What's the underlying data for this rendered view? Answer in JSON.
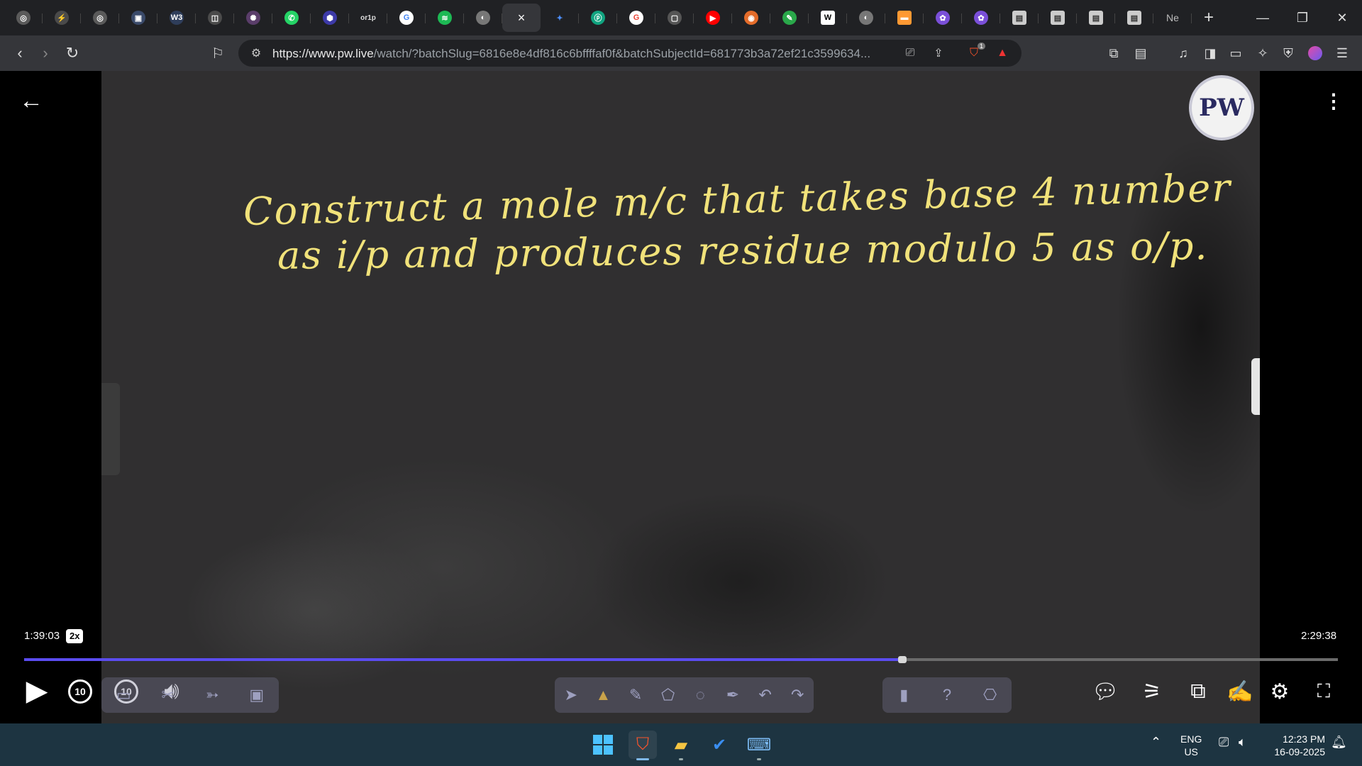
{
  "browser": {
    "tabs": [
      {
        "icon": "openai-icon",
        "glyph": "◎",
        "color": "#5a5a5a"
      },
      {
        "icon": "ai-logo-icon",
        "glyph": "⚡",
        "color": "#4a4a4a"
      },
      {
        "icon": "openai-icon",
        "glyph": "◎",
        "color": "#5a5a5a"
      },
      {
        "icon": "app-icon",
        "glyph": "▣",
        "color": "#3a4a6a"
      },
      {
        "icon": "w3schools-icon",
        "glyph": "W3",
        "color": "#2e3d5a"
      },
      {
        "icon": "app-icon",
        "glyph": "◫",
        "color": "#4a4a4a"
      },
      {
        "icon": "perplexity-icon",
        "glyph": "✺",
        "color": "#5a3d6a"
      },
      {
        "icon": "whatsapp-icon",
        "glyph": "✆",
        "color": "#25d366"
      },
      {
        "icon": "shield-app-icon",
        "glyph": "⬢",
        "color": "#3d3aa8"
      },
      {
        "icon": "text-logo-icon",
        "text": "or1p"
      },
      {
        "icon": "google-icon",
        "glyph": "G",
        "color": "#ffffff",
        "fg": "#4285f4"
      },
      {
        "icon": "spotify-icon",
        "glyph": "≋",
        "color": "#1db954"
      },
      {
        "icon": "globe-icon",
        "glyph": "◐",
        "color": "#777777"
      },
      {
        "icon": "close-icon",
        "close": "×",
        "active": true
      },
      {
        "icon": "gemini-icon",
        "glyph": "✦",
        "color": "#202124",
        "fg": "#4c8df6"
      },
      {
        "icon": "app-icon",
        "glyph": "ⓟ",
        "color": "#10a37f"
      },
      {
        "icon": "google-icon",
        "glyph": "G",
        "color": "#ffffff",
        "fg": "#ea4335"
      },
      {
        "icon": "app-icon",
        "glyph": "▢",
        "color": "#555555"
      },
      {
        "icon": "youtube-icon",
        "glyph": "▶",
        "color": "#ff0000"
      },
      {
        "icon": "app-icon",
        "glyph": "◉",
        "color": "#e46c2a"
      },
      {
        "icon": "app-icon",
        "glyph": "✎",
        "color": "#2aa84a"
      },
      {
        "icon": "wikipedia-icon",
        "glyph": "W",
        "color": "#ffffff",
        "fg": "#000000",
        "square": true
      },
      {
        "icon": "globe-icon",
        "glyph": "◐",
        "color": "#777777"
      },
      {
        "icon": "flag-india-icon",
        "glyph": "▬",
        "color": "#ff9933",
        "square": true
      },
      {
        "icon": "app-icon",
        "glyph": "✿",
        "color": "#7a4fd8"
      },
      {
        "icon": "app-icon",
        "glyph": "✿",
        "color": "#7a4fd8"
      },
      {
        "icon": "doc-icon",
        "glyph": "▤",
        "color": "#cccccc",
        "fg": "#333333",
        "square": true
      },
      {
        "icon": "doc-icon",
        "glyph": "▤",
        "color": "#cccccc",
        "fg": "#333333",
        "square": true
      },
      {
        "icon": "doc-icon",
        "glyph": "▤",
        "color": "#cccccc",
        "fg": "#333333",
        "square": true
      },
      {
        "icon": "doc-icon",
        "glyph": "▤",
        "color": "#cccccc",
        "fg": "#333333",
        "square": true
      },
      {
        "text_label": "Ne"
      }
    ],
    "new_tab": "+",
    "url": "https://www.pw.live/watch/?batchSlug=6816e8e4df816c6bffffaf0f&batchSubjectId=681773b3a72ef21c3599634...",
    "url_host": "https://www.pw.live",
    "url_rest": "/watch/?batchSlug=6816e8e4df816c6bffffaf0f&batchSubjectId=681773b3a72ef21c3599634...",
    "shield_badge": "1"
  },
  "player": {
    "board_line_1": "Construct a mole m/c that takes base 4 number",
    "board_line_2": "as i/p and produces residue modulo 5 as o/p.",
    "logo_text": "PW",
    "time_current": "1:39:03",
    "speed": "2x",
    "time_total": "2:29:38",
    "progress": 0.6685,
    "rewind_label": "10",
    "forward_label": "10"
  },
  "taskbar": {
    "lang_1": "ENG",
    "lang_2": "US",
    "time": "12:23 PM",
    "date": "16-09-2025"
  },
  "colors": {
    "accent": "#5b4cf0",
    "chalk": "#f1e27a",
    "board": "#302f30"
  }
}
